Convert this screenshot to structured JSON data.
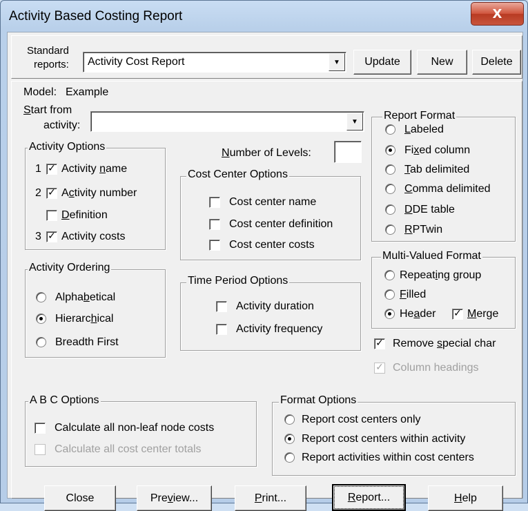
{
  "window": {
    "title": "Activity Based Costing Report",
    "close_glyph": "X"
  },
  "standard_reports": {
    "label_line1": "Standard",
    "label_line2": "reports:",
    "value": "Activity Cost Report",
    "update_label": "Update",
    "new_label": "New",
    "delete_label": "Delete"
  },
  "model": {
    "label": "Model:",
    "value": "Example"
  },
  "start_from": {
    "label_line1": "tart from",
    "label_line1_accel": "S",
    "label_line2": "activity:",
    "value": ""
  },
  "number_of_levels": {
    "label_accel": "N",
    "label_rest": "umber of Levels:",
    "value": ""
  },
  "activity_options": {
    "title": "Activity Options",
    "items": [
      {
        "index": "1",
        "pre": "Activity ",
        "accel": "n",
        "post": "ame",
        "checked": true
      },
      {
        "index": "2",
        "pre": "A",
        "accel": "c",
        "post": "tivity number",
        "checked": true
      },
      {
        "index": "",
        "pre": "",
        "accel": "D",
        "post": "efinition",
        "checked": false
      },
      {
        "index": "3",
        "pre": "Activity costs",
        "accel": "",
        "post": "",
        "checked": true
      }
    ]
  },
  "cost_center_options": {
    "title": "Cost Center Options",
    "items": [
      "Cost center name",
      "Cost center definition",
      "Cost center costs"
    ]
  },
  "report_format": {
    "title": "Report Format",
    "items": [
      {
        "pre": "",
        "accel": "L",
        "post": "abeled",
        "selected": false
      },
      {
        "pre": "Fi",
        "accel": "x",
        "post": "ed column",
        "selected": true
      },
      {
        "pre": "",
        "accel": "T",
        "post": "ab delimited",
        "selected": false
      },
      {
        "pre": "",
        "accel": "C",
        "post": "omma delimited",
        "selected": false
      },
      {
        "pre": "",
        "accel": "D",
        "post": "DE table",
        "selected": false
      },
      {
        "pre": "",
        "accel": "R",
        "post": "PTwin",
        "selected": false
      }
    ]
  },
  "activity_ordering": {
    "title": "Activity Ordering",
    "items": [
      {
        "pre": "Alpha",
        "accel": "b",
        "post": "etical",
        "selected": false
      },
      {
        "pre": "Hierarc",
        "accel": "h",
        "post": "ical",
        "selected": true
      },
      {
        "pre": "Breadth First",
        "accel": "",
        "post": "",
        "selected": false
      }
    ]
  },
  "time_period_options": {
    "title": "Time Period Options",
    "items": [
      "Activity duration",
      "Activity frequency"
    ]
  },
  "multi_valued_format": {
    "title": "Multi-Valued Format",
    "repeating": {
      "pre": "Repeat",
      "accel": "i",
      "post": "ng group"
    },
    "filled": {
      "pre": "",
      "accel": "F",
      "post": "illed"
    },
    "header": {
      "pre": "He",
      "accel": "a",
      "post": "der"
    },
    "merge": {
      "pre": "",
      "accel": "M",
      "post": "erge"
    }
  },
  "remove_special": {
    "pre": "Remove ",
    "accel": "s",
    "post": "pecial char"
  },
  "column_headings": "Column headings",
  "abc_options": {
    "title": "A B C  Options",
    "items": [
      "Calculate all non-leaf node costs",
      "Calculate all cost center totals"
    ]
  },
  "format_options": {
    "title": "Format Options",
    "items": [
      "Report cost centers only",
      "Report cost centers within activity",
      "Report activities within cost centers"
    ]
  },
  "buttons": {
    "close": "Close",
    "preview_pre": "Pre",
    "preview_accel": "v",
    "preview_post": "iew...",
    "print_accel": "P",
    "print_post": "rint...",
    "report_accel": "R",
    "report_post": "eport...",
    "help_accel": "H",
    "help_post": "elp"
  },
  "icons": {
    "checkmark": "check-icon",
    "dropdown": "chevron-down-icon"
  }
}
